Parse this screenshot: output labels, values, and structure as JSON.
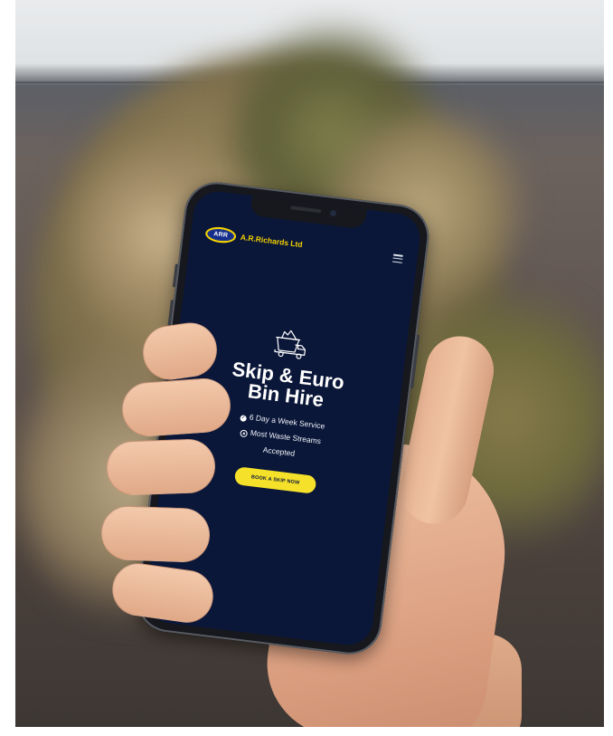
{
  "site": {
    "logo_text": "ARR",
    "brand_name": "A.R.Richards Ltd"
  },
  "hero": {
    "title_line1": "Skip & Euro",
    "title_line2": "Bin Hire",
    "features": [
      {
        "icon": "check-circle-icon",
        "text": "6 Day a Week Service"
      },
      {
        "icon": "thumbs-up-icon",
        "text": "Most Waste Streams"
      },
      {
        "icon": "",
        "text": "Accepted"
      }
    ],
    "cta_label": "BOOK A SKIP NOW"
  },
  "colors": {
    "screen_background": "#0b1739",
    "accent_yellow": "#f6e12a",
    "hero_text": "#ffffff",
    "logo_blue": "#142d8c"
  }
}
